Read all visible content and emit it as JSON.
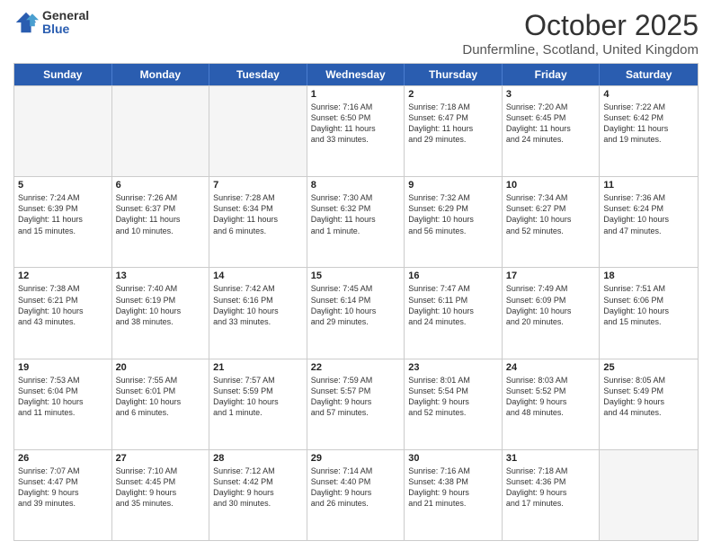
{
  "logo": {
    "general": "General",
    "blue": "Blue"
  },
  "title": "October 2025",
  "location": "Dunfermline, Scotland, United Kingdom",
  "header_days": [
    "Sunday",
    "Monday",
    "Tuesday",
    "Wednesday",
    "Thursday",
    "Friday",
    "Saturday"
  ],
  "weeks": [
    [
      {
        "day": "",
        "info": ""
      },
      {
        "day": "",
        "info": ""
      },
      {
        "day": "",
        "info": ""
      },
      {
        "day": "1",
        "info": "Sunrise: 7:16 AM\nSunset: 6:50 PM\nDaylight: 11 hours\nand 33 minutes."
      },
      {
        "day": "2",
        "info": "Sunrise: 7:18 AM\nSunset: 6:47 PM\nDaylight: 11 hours\nand 29 minutes."
      },
      {
        "day": "3",
        "info": "Sunrise: 7:20 AM\nSunset: 6:45 PM\nDaylight: 11 hours\nand 24 minutes."
      },
      {
        "day": "4",
        "info": "Sunrise: 7:22 AM\nSunset: 6:42 PM\nDaylight: 11 hours\nand 19 minutes."
      }
    ],
    [
      {
        "day": "5",
        "info": "Sunrise: 7:24 AM\nSunset: 6:39 PM\nDaylight: 11 hours\nand 15 minutes."
      },
      {
        "day": "6",
        "info": "Sunrise: 7:26 AM\nSunset: 6:37 PM\nDaylight: 11 hours\nand 10 minutes."
      },
      {
        "day": "7",
        "info": "Sunrise: 7:28 AM\nSunset: 6:34 PM\nDaylight: 11 hours\nand 6 minutes."
      },
      {
        "day": "8",
        "info": "Sunrise: 7:30 AM\nSunset: 6:32 PM\nDaylight: 11 hours\nand 1 minute."
      },
      {
        "day": "9",
        "info": "Sunrise: 7:32 AM\nSunset: 6:29 PM\nDaylight: 10 hours\nand 56 minutes."
      },
      {
        "day": "10",
        "info": "Sunrise: 7:34 AM\nSunset: 6:27 PM\nDaylight: 10 hours\nand 52 minutes."
      },
      {
        "day": "11",
        "info": "Sunrise: 7:36 AM\nSunset: 6:24 PM\nDaylight: 10 hours\nand 47 minutes."
      }
    ],
    [
      {
        "day": "12",
        "info": "Sunrise: 7:38 AM\nSunset: 6:21 PM\nDaylight: 10 hours\nand 43 minutes."
      },
      {
        "day": "13",
        "info": "Sunrise: 7:40 AM\nSunset: 6:19 PM\nDaylight: 10 hours\nand 38 minutes."
      },
      {
        "day": "14",
        "info": "Sunrise: 7:42 AM\nSunset: 6:16 PM\nDaylight: 10 hours\nand 33 minutes."
      },
      {
        "day": "15",
        "info": "Sunrise: 7:45 AM\nSunset: 6:14 PM\nDaylight: 10 hours\nand 29 minutes."
      },
      {
        "day": "16",
        "info": "Sunrise: 7:47 AM\nSunset: 6:11 PM\nDaylight: 10 hours\nand 24 minutes."
      },
      {
        "day": "17",
        "info": "Sunrise: 7:49 AM\nSunset: 6:09 PM\nDaylight: 10 hours\nand 20 minutes."
      },
      {
        "day": "18",
        "info": "Sunrise: 7:51 AM\nSunset: 6:06 PM\nDaylight: 10 hours\nand 15 minutes."
      }
    ],
    [
      {
        "day": "19",
        "info": "Sunrise: 7:53 AM\nSunset: 6:04 PM\nDaylight: 10 hours\nand 11 minutes."
      },
      {
        "day": "20",
        "info": "Sunrise: 7:55 AM\nSunset: 6:01 PM\nDaylight: 10 hours\nand 6 minutes."
      },
      {
        "day": "21",
        "info": "Sunrise: 7:57 AM\nSunset: 5:59 PM\nDaylight: 10 hours\nand 1 minute."
      },
      {
        "day": "22",
        "info": "Sunrise: 7:59 AM\nSunset: 5:57 PM\nDaylight: 9 hours\nand 57 minutes."
      },
      {
        "day": "23",
        "info": "Sunrise: 8:01 AM\nSunset: 5:54 PM\nDaylight: 9 hours\nand 52 minutes."
      },
      {
        "day": "24",
        "info": "Sunrise: 8:03 AM\nSunset: 5:52 PM\nDaylight: 9 hours\nand 48 minutes."
      },
      {
        "day": "25",
        "info": "Sunrise: 8:05 AM\nSunset: 5:49 PM\nDaylight: 9 hours\nand 44 minutes."
      }
    ],
    [
      {
        "day": "26",
        "info": "Sunrise: 7:07 AM\nSunset: 4:47 PM\nDaylight: 9 hours\nand 39 minutes."
      },
      {
        "day": "27",
        "info": "Sunrise: 7:10 AM\nSunset: 4:45 PM\nDaylight: 9 hours\nand 35 minutes."
      },
      {
        "day": "28",
        "info": "Sunrise: 7:12 AM\nSunset: 4:42 PM\nDaylight: 9 hours\nand 30 minutes."
      },
      {
        "day": "29",
        "info": "Sunrise: 7:14 AM\nSunset: 4:40 PM\nDaylight: 9 hours\nand 26 minutes."
      },
      {
        "day": "30",
        "info": "Sunrise: 7:16 AM\nSunset: 4:38 PM\nDaylight: 9 hours\nand 21 minutes."
      },
      {
        "day": "31",
        "info": "Sunrise: 7:18 AM\nSunset: 4:36 PM\nDaylight: 9 hours\nand 17 minutes."
      },
      {
        "day": "",
        "info": ""
      }
    ]
  ]
}
